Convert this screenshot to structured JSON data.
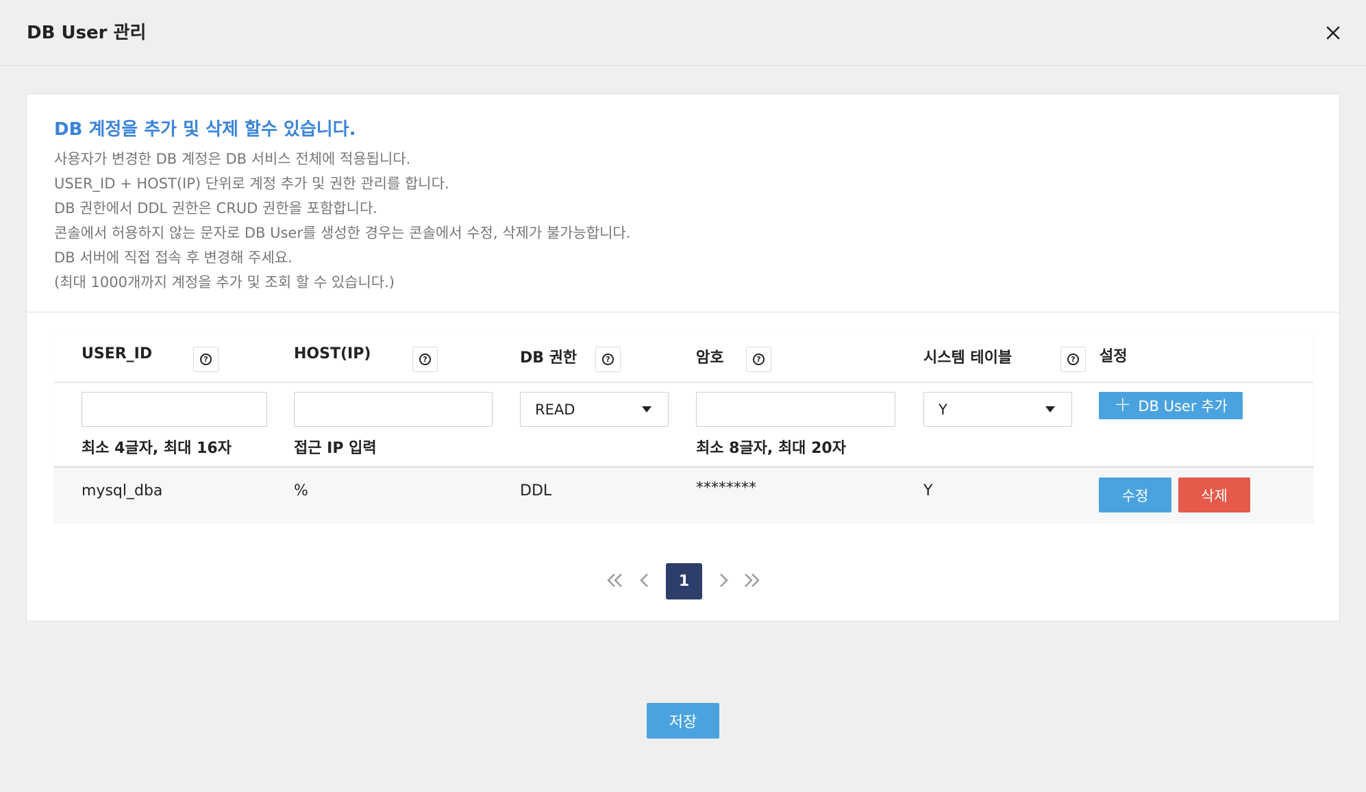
{
  "dialog": {
    "title": "DB User 관리",
    "close_icon": "close-icon"
  },
  "info": {
    "title": "DB 계정을 추가 및 삭제 할수 있습니다.",
    "lines": [
      "사용자가 변경한 DB 계정은 DB 서비스 전체에 적용됩니다.",
      "USER_ID + HOST(IP) 단위로 계정 추가 및 권한 관리를 합니다.",
      "DB 권한에서 DDL 권한은 CRUD 권한을 포함합니다.",
      "콘솔에서 허용하지 않는 문자로 DB User를 생성한 경우는 콘솔에서 수정, 삭제가 불가능합니다.",
      "DB 서버에 직접 접속 후 변경해 주세요.",
      "(최대 1000개까지 계정을 추가 및 조회 할 수 있습니다.)"
    ]
  },
  "table": {
    "columns": [
      "USER_ID",
      "HOST(IP)",
      "DB 권한",
      "암호",
      "시스템 테이블",
      "설정"
    ],
    "new_row": {
      "user_id_value": "",
      "host_value": "",
      "privilege_selected": "READ",
      "password_value": "",
      "system_table_selected": "Y",
      "add_button_label": "DB User 추가",
      "hints": {
        "user_id": "최소 4글자, 최대 16자",
        "host": "접근 IP 입력",
        "password": "최소 8글자, 최대 20자"
      }
    },
    "rows": [
      {
        "user_id": "mysql_dba",
        "host": "%",
        "privilege": "DDL",
        "password": "********",
        "system_table": "Y",
        "edit_label": "수정",
        "delete_label": "삭제"
      }
    ]
  },
  "pagination": {
    "current_page": "1"
  },
  "footer": {
    "save_label": "저장"
  },
  "colors": {
    "accent": "#3a84d8",
    "button_blue": "#4aa3df",
    "button_red": "#e55a4a",
    "page_active": "#2d3e6b"
  }
}
